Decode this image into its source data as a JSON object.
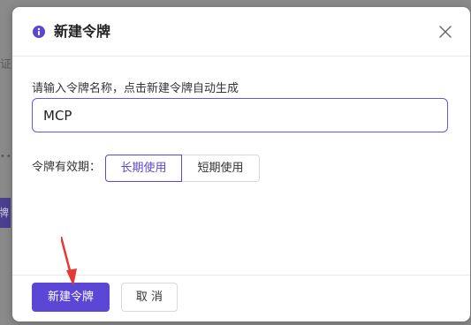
{
  "background": {
    "partial_text_1": "证",
    "partial_text_2": "牌",
    "dots": "•••"
  },
  "dialog": {
    "title": "新建令牌",
    "icon": "info-icon",
    "close_icon": "close-icon",
    "name_label": "请输入令牌名称，点击新建令牌自动生成",
    "name_value": "MCP",
    "validity_label": "令牌有效期：",
    "validity_options": [
      {
        "label": "长期使用",
        "selected": true
      },
      {
        "label": "短期使用",
        "selected": false
      }
    ],
    "create_button": "新建令牌",
    "cancel_button": "取 消"
  },
  "colors": {
    "accent": "#5b47d6",
    "annotation_arrow": "#e53935"
  }
}
